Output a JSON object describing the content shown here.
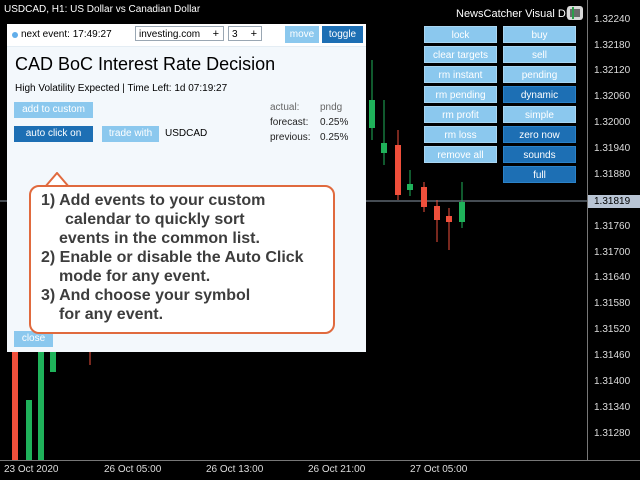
{
  "chart": {
    "symbol_title": "USDCAD, H1:  US Dollar vs Canadian Dollar",
    "app_name": "NewsCatcher Visual DEV",
    "price_levels": [
      "1.32240",
      "1.32180",
      "1.32120",
      "1.32060",
      "1.32000",
      "1.31940",
      "1.31880",
      "1.31819",
      "1.31760",
      "1.31700",
      "1.31640",
      "1.31580",
      "1.31520",
      "1.31460",
      "1.31400",
      "1.31340",
      "1.31280"
    ],
    "current_price": "1.31819",
    "time_labels": [
      "23 Oct 2020",
      "26 Oct 05:00",
      "26 Oct 13:00",
      "26 Oct 21:00",
      "27 Oct 05:00"
    ],
    "colors": {
      "bull": "#1fb25a",
      "bear": "#ef4f3b",
      "axis": "#777777",
      "bg": "#000000"
    }
  },
  "buttons": {
    "left": [
      "lock",
      "clear targets",
      "rm instant",
      "rm pending",
      "rm profit",
      "rm loss",
      "remove all"
    ],
    "right": [
      "buy",
      "sell",
      "pending",
      "dynamic",
      "simple",
      "zero now",
      "sounds",
      "full"
    ]
  },
  "panel": {
    "next_event": "next event: 17:49:27",
    "source": "investing.com",
    "source_plus": "+",
    "count": "3",
    "count_plus": "+",
    "move_label": "move",
    "toggle_label": "toggle",
    "event_title": "CAD BoC Interest Rate Decision",
    "volatility": "High Volatility Expected | Time Left: 1d 07:19:27",
    "add_to_custom": "add to custom",
    "auto_click": "auto click on",
    "trade_with": "trade with",
    "symbol": "USDCAD",
    "actual_label": "actual:",
    "actual_value": "pndg",
    "forecast_label": "forecast:",
    "forecast_value": "0.25%",
    "previous_label": "previous:",
    "previous_value": "0.25%",
    "close_label": "close",
    "colors": {
      "light_btn": "#8bc8ee",
      "dark_btn": "#1d6fb4",
      "callout_border": "#e06a3e"
    }
  },
  "callout": {
    "line1": "1) Add events to your custom",
    "line2": "calendar to quickly sort",
    "line3": "events in the common list.",
    "line4": "2) Enable or disable the Auto Click",
    "line5": "mode for any event.",
    "line6": "3) And choose your symbol",
    "line7": "for any event."
  }
}
